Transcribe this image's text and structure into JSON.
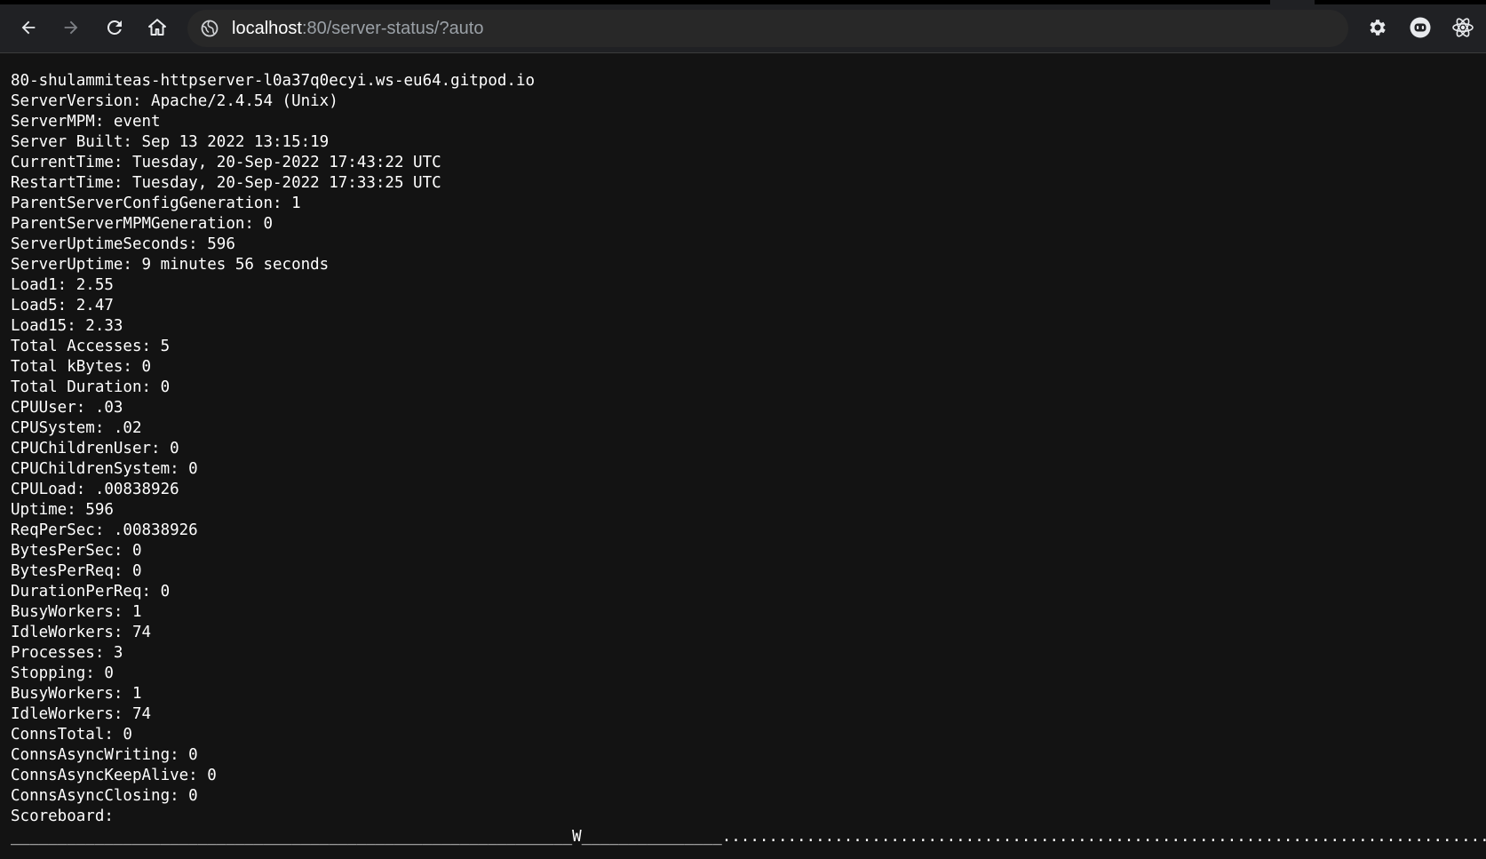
{
  "browser": {
    "url_host": "localhost",
    "url_path": ":80/server-status/?auto",
    "back_icon": "arrow-left-icon",
    "forward_icon": "arrow-right-icon",
    "reload_icon": "reload-icon",
    "home_icon": "home-icon",
    "site_info_icon": "site-info-icon",
    "extensions": [
      "gear-icon",
      "github-copilot-icon",
      "react-icon"
    ],
    "colors": {
      "toolbar": "#202124",
      "omnibox": "#282828",
      "page_bg": "#131313",
      "text": "#ffffff",
      "url_path": "#9aa0a6"
    }
  },
  "status": {
    "lines": [
      "80-shulammiteas-httpserver-l0a37q0ecyi.ws-eu64.gitpod.io",
      "ServerVersion: Apache/2.4.54 (Unix)",
      "ServerMPM: event",
      "Server Built: Sep 13 2022 13:15:19",
      "CurrentTime: Tuesday, 20-Sep-2022 17:43:22 UTC",
      "RestartTime: Tuesday, 20-Sep-2022 17:33:25 UTC",
      "ParentServerConfigGeneration: 1",
      "ParentServerMPMGeneration: 0",
      "ServerUptimeSeconds: 596",
      "ServerUptime: 9 minutes 56 seconds",
      "Load1: 2.55",
      "Load5: 2.47",
      "Load15: 2.33",
      "Total Accesses: 5",
      "Total kBytes: 0",
      "Total Duration: 0",
      "CPUUser: .03",
      "CPUSystem: .02",
      "CPUChildrenUser: 0",
      "CPUChildrenSystem: 0",
      "CPULoad: .00838926",
      "Uptime: 596",
      "ReqPerSec: .00838926",
      "BytesPerSec: 0",
      "BytesPerReq: 0",
      "DurationPerReq: 0",
      "BusyWorkers: 1",
      "IdleWorkers: 74",
      "Processes: 3",
      "Stopping: 0",
      "BusyWorkers: 1",
      "IdleWorkers: 74",
      "ConnsTotal: 0",
      "ConnsAsyncWriting: 0",
      "ConnsAsyncKeepAlive: 0",
      "ConnsAsyncClosing: 0",
      "Scoreboard:"
    ],
    "scoreboard": "____________________________________________________________W_______________......................................................................................................................................................................................................................................................................................................................................................................................................"
  }
}
